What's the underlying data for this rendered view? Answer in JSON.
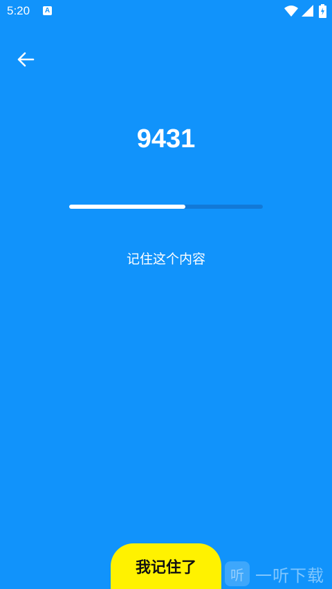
{
  "status_bar": {
    "time": "5:20",
    "notification_icon": "A",
    "icons": [
      "wifi-icon",
      "signal-icon",
      "battery-icon"
    ]
  },
  "header": {
    "back_icon": "arrow-left-icon"
  },
  "main": {
    "number": "9431",
    "progress": 0.6,
    "instruction": "记住这个内容"
  },
  "footer": {
    "button_label": "我记住了"
  },
  "watermark": {
    "logo_glyph": "听",
    "text": "一听下载"
  },
  "colors": {
    "background": "#1193FB",
    "button": "#FFF200",
    "progress_fill": "#FFFFFF"
  }
}
